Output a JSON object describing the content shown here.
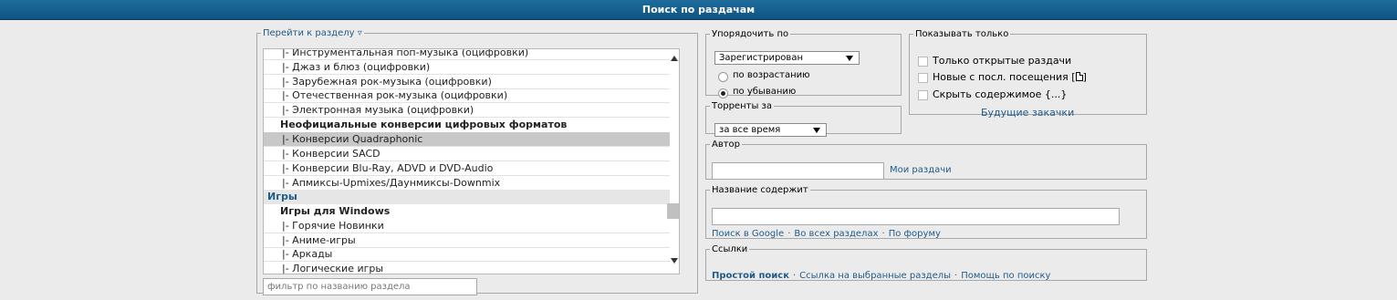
{
  "header": {
    "title": "Поиск по раздачам"
  },
  "section_picker": {
    "legend": "Перейти к разделу",
    "filter_placeholder": "фильтр по названию раздела",
    "items": [
      {
        "label": "|- Инструментальная поп-музыка (оцифровки)",
        "kind": "sub",
        "selected": false
      },
      {
        "label": "|- Джаз и блюз (оцифровки)",
        "kind": "sub",
        "selected": false
      },
      {
        "label": "|- Зарубежная рок-музыка (оцифровки)",
        "kind": "sub",
        "selected": false
      },
      {
        "label": "|- Отечественная рок-музыка (оцифровки)",
        "kind": "sub",
        "selected": false
      },
      {
        "label": "|- Электронная музыка (оцифровки)",
        "kind": "sub",
        "selected": false
      },
      {
        "label": "Неофициальные конверсии цифровых форматов",
        "kind": "grp",
        "selected": false
      },
      {
        "label": "|- Конверсии Quadraphonic",
        "kind": "sub",
        "selected": true
      },
      {
        "label": "|- Конверсии SACD",
        "kind": "sub",
        "selected": false
      },
      {
        "label": "|- Конверсии Blu-Ray, ADVD и DVD-Audio",
        "kind": "sub",
        "selected": false
      },
      {
        "label": "|- Апмиксы-Upmixes/Даунмиксы-Downmix",
        "kind": "sub",
        "selected": false
      },
      {
        "label": "Игры",
        "kind": "sec",
        "selected": false
      },
      {
        "label": "Игры для Windows",
        "kind": "grp",
        "selected": false
      },
      {
        "label": "|- Горячие Новинки",
        "kind": "sub",
        "selected": false
      },
      {
        "label": "|- Аниме-игры",
        "kind": "sub",
        "selected": false
      },
      {
        "label": "|- Аркады",
        "kind": "sub",
        "selected": false
      },
      {
        "label": "|- Логические игры",
        "kind": "sub",
        "selected": false
      }
    ]
  },
  "sort": {
    "legend": "Упорядочить по",
    "selected": "Зарегистрирован",
    "asc_label": "по возрастанию",
    "desc_label": "по убыванию",
    "order": "desc"
  },
  "torrents_for": {
    "legend": "Торренты за",
    "selected": "за все время"
  },
  "show_only": {
    "legend": "Показывать только",
    "open_only": "Только открытые раздачи",
    "new_since": "Новые с посл. посещения [",
    "new_since_end": "]",
    "hide_contents": "Скрыть содержимое {...}",
    "future_downloads": "Будущие закачки"
  },
  "author": {
    "legend": "Автор",
    "value": "",
    "my_torrents": "Мои раздачи"
  },
  "title_contains": {
    "legend": "Название содержит",
    "value": "",
    "search_google": "Поиск в Google",
    "all_sections": "Во всех разделах",
    "forum": "По форуму",
    "separator": "·"
  },
  "links": {
    "legend": "Ссылки",
    "simple_search": "Простой поиск",
    "selected_sections_link": "Ссылка на выбранные разделы",
    "search_help": "Помощь по поиску",
    "separator": "·"
  }
}
